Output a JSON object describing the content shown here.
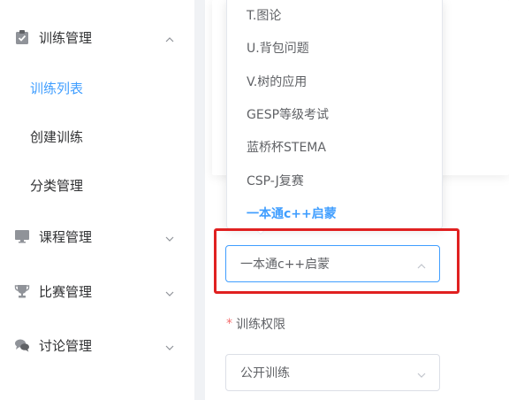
{
  "sidebar": {
    "groups": [
      {
        "label": "训练管理",
        "icon": "clipboard-check-icon",
        "expanded": true
      },
      {
        "label": "课程管理",
        "icon": "monitor-icon",
        "expanded": false
      },
      {
        "label": "比赛管理",
        "icon": "trophy-icon",
        "expanded": false
      },
      {
        "label": "讨论管理",
        "icon": "chat-bubbles-icon",
        "expanded": false
      }
    ],
    "training_items": [
      {
        "label": "训练列表",
        "active": true
      },
      {
        "label": "创建训练",
        "active": false
      },
      {
        "label": "分类管理",
        "active": false
      }
    ]
  },
  "dropdown": {
    "options": [
      {
        "label": "T.图论",
        "selected": false
      },
      {
        "label": "U.背包问题",
        "selected": false
      },
      {
        "label": "V.树的应用",
        "selected": false
      },
      {
        "label": "GESP等级考试",
        "selected": false
      },
      {
        "label": "蓝桥杯STEMA",
        "selected": false
      },
      {
        "label": "CSP-J复赛",
        "selected": false
      },
      {
        "label": "一本通c++启蒙",
        "selected": true
      }
    ]
  },
  "form": {
    "category_select": {
      "value": "一本通c++启蒙"
    },
    "permission_label": "训练权限",
    "permission_required_mark": "*",
    "permission_select": {
      "value": "公开训练"
    }
  },
  "colors": {
    "accent": "#409eff",
    "highlight_box": "#e02020",
    "required": "#f56c6c"
  }
}
